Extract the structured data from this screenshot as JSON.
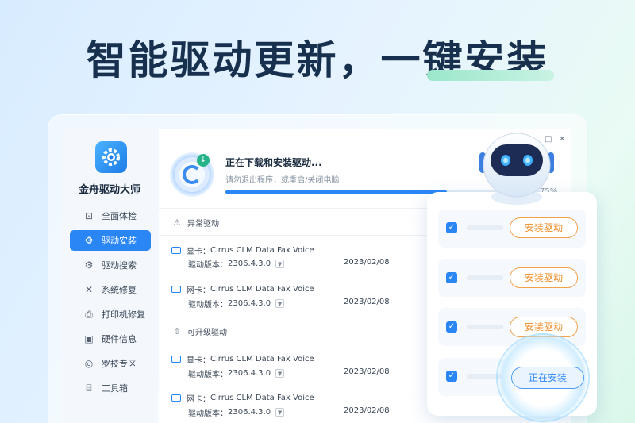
{
  "banner": {
    "headline": "智能驱动更新，一键安装"
  },
  "sidebar": {
    "app_name": "金舟驱动大师",
    "items": [
      {
        "label": "全面体检",
        "icon": "monitor-icon",
        "glyph": "⊡"
      },
      {
        "label": "驱动安装",
        "icon": "gear-icon",
        "glyph": "⚙"
      },
      {
        "label": "驱动搜索",
        "icon": "search-gear-icon",
        "glyph": "⚙"
      },
      {
        "label": "系统修复",
        "icon": "wrench-icon",
        "glyph": "✕"
      },
      {
        "label": "打印机修复",
        "icon": "printer-icon",
        "glyph": "⎙"
      },
      {
        "label": "硬件信息",
        "icon": "chip-icon",
        "glyph": "▣"
      },
      {
        "label": "罗技专区",
        "icon": "logitech-icon",
        "glyph": "◎"
      },
      {
        "label": "工具箱",
        "icon": "toolbox-icon",
        "glyph": "⌸"
      }
    ],
    "active_index": 1
  },
  "download": {
    "title": "正在下载和安装驱动...",
    "subtitle": "请勿退出程序，或重启/关闭电脑",
    "percent_label": "75%",
    "progress": 0.7
  },
  "window_controls": {
    "restore": "□",
    "close": "✕"
  },
  "sections": {
    "abnormal": {
      "title": "异常驱动",
      "rows": [
        {
          "type_label": "显卡：",
          "name": "Cirrus CLM Data Fax Voice",
          "version_label": "驱动版本：",
          "version": "2306.4.3.0",
          "date": "2023/02/08"
        },
        {
          "type_label": "网卡：",
          "name": "Cirrus CLM Data Fax Voice",
          "version_label": "驱动版本：",
          "version": "2306.4.3.0",
          "date": "2023/02/08"
        }
      ]
    },
    "upgradable": {
      "title": "可升级驱动",
      "rows": [
        {
          "type_label": "显卡：",
          "name": "Cirrus CLM Data Fax Voice",
          "version_label": "驱动版本：",
          "version": "2306.4.3.0",
          "date": "2023/02/08"
        },
        {
          "type_label": "网卡：",
          "name": "Cirrus CLM Data Fax Voice",
          "version_label": "驱动版本：",
          "version": "2306.4.3.0",
          "date": "2023/02/08"
        }
      ]
    }
  },
  "install_panel": {
    "buttons": [
      "安装驱动",
      "安装驱动",
      "安装驱动"
    ],
    "installing_label": "正在安装"
  },
  "colors": {
    "accent": "#2b86f5",
    "install_orange": "#f08a24",
    "headline": "#17304d"
  }
}
